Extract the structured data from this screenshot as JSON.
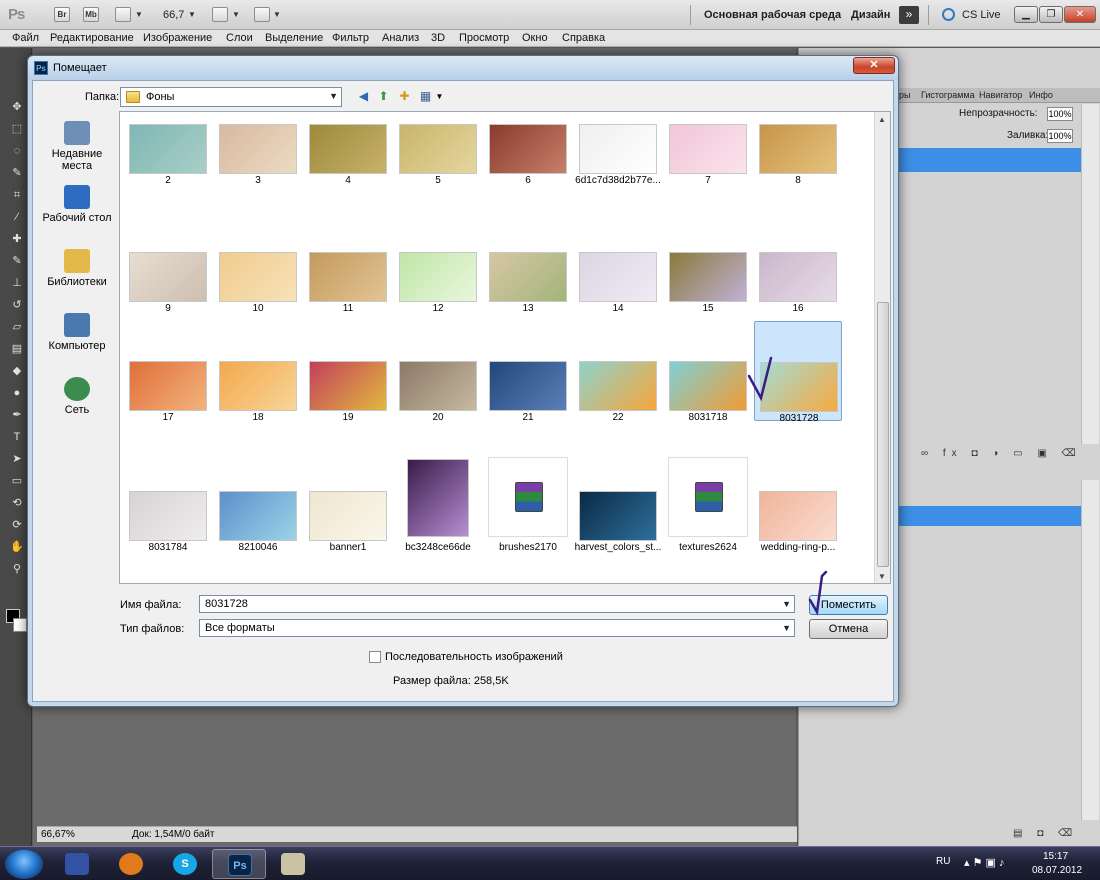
{
  "appbar": {
    "logo": "Ps",
    "buttons": [
      "Br",
      "Mb"
    ],
    "zoom": "66,7",
    "workspace": "Основная рабочая среда",
    "design": "Дизайн",
    "cslive": "CS Live"
  },
  "menu": [
    "Файл",
    "Редактирование",
    "Изображение",
    "Слои",
    "Выделение",
    "Фильтр",
    "Анализ",
    "3D",
    "Просмотр",
    "Окно",
    "Справка"
  ],
  "panels": {
    "tabs": [
      "ры",
      "Гистограмма",
      "Навигатор",
      "Инфо"
    ],
    "opacity_label": "Непрозрачность:",
    "opacity_value": "100%",
    "fill_label": "Заливка:",
    "fill_value": "100%"
  },
  "status": {
    "zoom": "66,67%",
    "doc": "Док: 1,54M/0 байт"
  },
  "dialog": {
    "title": "Помещает",
    "folder_label": "Папка:",
    "folder_value": "Фоны",
    "places": [
      {
        "label": "Недавние места",
        "icon": "recent-places-icon",
        "color": "#6e8fb5"
      },
      {
        "label": "Рабочий стол",
        "icon": "desktop-icon",
        "color": "#2d6cc0"
      },
      {
        "label": "Библиотеки",
        "icon": "libraries-icon",
        "color": "#e3b94a"
      },
      {
        "label": "Компьютер",
        "icon": "computer-icon",
        "color": "#4a79b0"
      },
      {
        "label": "Сеть",
        "icon": "network-icon",
        "color": "#3b8d4f"
      }
    ],
    "files": [
      {
        "name": "2",
        "colors": [
          "#7fb7b5",
          "#a9cfc7"
        ]
      },
      {
        "name": "3",
        "colors": [
          "#d9b8a0",
          "#eadcc2"
        ]
      },
      {
        "name": "4",
        "colors": [
          "#9c8a3a",
          "#c8b26a"
        ]
      },
      {
        "name": "5",
        "colors": [
          "#c8b56a",
          "#e5d6a0"
        ]
      },
      {
        "name": "6",
        "colors": [
          "#8b3a2e",
          "#c6806a"
        ]
      },
      {
        "name": "6d1c7d38d2b77e...",
        "colors": [
          "#efefef",
          "#ffffff"
        ]
      },
      {
        "name": "7",
        "colors": [
          "#f2c6d8",
          "#fae3ec"
        ]
      },
      {
        "name": "8",
        "colors": [
          "#c8944a",
          "#e5c27c"
        ]
      },
      {
        "name": "9",
        "colors": [
          "#e7ddd2",
          "#cdbfb1"
        ]
      },
      {
        "name": "10",
        "colors": [
          "#f1cc8e",
          "#f7e2b8"
        ]
      },
      {
        "name": "11",
        "colors": [
          "#c39a5e",
          "#e2c493"
        ]
      },
      {
        "name": "12",
        "colors": [
          "#bfe6a8",
          "#e9f6dc"
        ]
      },
      {
        "name": "13",
        "colors": [
          "#d7c6a5",
          "#a3b57a"
        ]
      },
      {
        "name": "14",
        "colors": [
          "#dcd6e4",
          "#efeaf3"
        ]
      },
      {
        "name": "15",
        "colors": [
          "#8a7a3a",
          "#c0b1d6"
        ]
      },
      {
        "name": "16",
        "colors": [
          "#cbb6cc",
          "#e7dbe8"
        ]
      },
      {
        "name": "17",
        "colors": [
          "#e06f3a",
          "#f2b37c"
        ]
      },
      {
        "name": "18",
        "colors": [
          "#f3a84d",
          "#f8d597"
        ]
      },
      {
        "name": "19",
        "colors": [
          "#c23f5c",
          "#e2b93e"
        ]
      },
      {
        "name": "20",
        "colors": [
          "#8a7a66",
          "#c8b9a2"
        ]
      },
      {
        "name": "21",
        "colors": [
          "#23467c",
          "#5b7fb8"
        ]
      },
      {
        "name": "22",
        "colors": [
          "#8ed2cc",
          "#f6a63a"
        ]
      },
      {
        "name": "8031718",
        "colors": [
          "#7ed0d6",
          "#f19b34"
        ]
      },
      {
        "name": "8031728",
        "colors": [
          "#a3dcd7",
          "#f7a93e"
        ]
      },
      {
        "name": "8031784",
        "colors": [
          "#d7d3d4",
          "#efeced"
        ]
      },
      {
        "name": "8210046",
        "colors": [
          "#5e8fcc",
          "#9ad4e6"
        ]
      },
      {
        "name": "banner1",
        "colors": [
          "#efe6d0",
          "#faf6ea"
        ]
      },
      {
        "name": "bc3248ce66de",
        "colors": [
          "#3a1b4a",
          "#b78fd3"
        ]
      },
      {
        "name": "brushes2170",
        "colors": [
          "#ffffff",
          "#ffffff"
        ]
      },
      {
        "name": "harvest_colors_st...",
        "colors": [
          "#0a2a44",
          "#2f6f9d"
        ]
      },
      {
        "name": "textures2624",
        "colors": [
          "#ffffff",
          "#ffffff"
        ]
      },
      {
        "name": "wedding-ring-p...",
        "colors": [
          "#f0b49a",
          "#fadcd0"
        ]
      }
    ],
    "selected_file": "8031728",
    "file_name_label": "Имя файла:",
    "file_name_value": "8031728",
    "file_type_label": "Тип файлов:",
    "file_type_value": "Все форматы",
    "place_button": "Поместить",
    "cancel_button": "Отмена",
    "sequence_label": "Последовательность изображений",
    "file_size": "Размер файла: 258,5K"
  },
  "taskbar": {
    "apps": [
      {
        "name": "save-disk-app",
        "glyph": "",
        "color": "#3452a3"
      },
      {
        "name": "firefox-app",
        "glyph": "",
        "color": "#e07a1c"
      },
      {
        "name": "skype-app",
        "glyph": "S",
        "color": "#17a6e6"
      },
      {
        "name": "photoshop-app",
        "glyph": "Ps",
        "color": "#0a2342"
      },
      {
        "name": "paint-app",
        "glyph": "",
        "color": "#c9c2a3"
      }
    ],
    "lang": "RU",
    "time": "15:17",
    "date": "08.07.2012"
  }
}
